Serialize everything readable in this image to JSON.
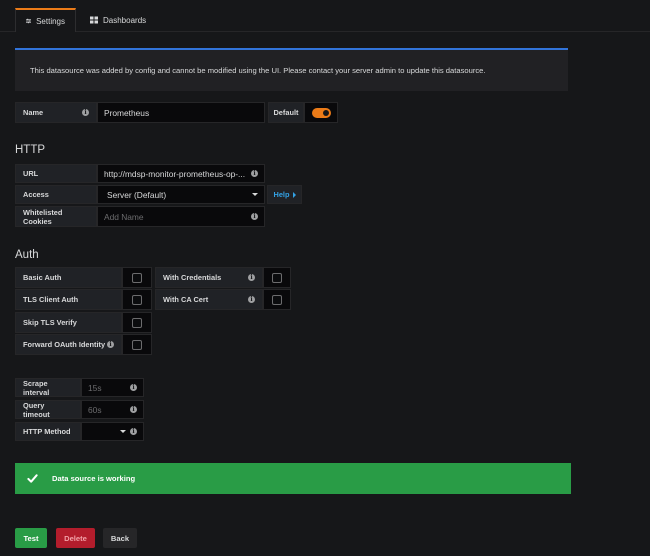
{
  "tabs": [
    {
      "label": "Settings",
      "icon": "sliders-icon",
      "active": true
    },
    {
      "label": "Dashboards",
      "icon": "grid-icon",
      "active": false
    }
  ],
  "banner": {
    "text": "This datasource was added by config and cannot be modified using the UI. Please contact your server admin to update this datasource."
  },
  "name_row": {
    "label": "Name",
    "value": "Prometheus",
    "default_label": "Default",
    "default_on": true
  },
  "http": {
    "heading": "HTTP",
    "url_label": "URL",
    "url_value": "http://mdsp-monitor-prometheus-op-...",
    "access_label": "Access",
    "access_value": "Server (Default)",
    "help_label": "Help",
    "cookies_label": "Whitelisted Cookies",
    "cookies_placeholder": "Add Name"
  },
  "auth": {
    "heading": "Auth",
    "basic_auth": "Basic Auth",
    "with_credentials": "With Credentials",
    "tls_client_auth": "TLS Client Auth",
    "with_ca_cert": "With CA Cert",
    "skip_tls_verify": "Skip TLS Verify",
    "forward_oauth": "Forward OAuth Identity"
  },
  "settings": {
    "scrape_label": "Scrape interval",
    "scrape_placeholder": "15s",
    "query_label": "Query timeout",
    "query_placeholder": "60s",
    "method_label": "HTTP Method",
    "method_value": ""
  },
  "status": {
    "text": "Data source is working",
    "color": "#299c46"
  },
  "buttons": {
    "test": "Test",
    "delete": "Delete",
    "back": "Back"
  },
  "colors": {
    "accent": "#eb7b18",
    "info_border": "#3274d9",
    "success": "#299c46",
    "danger": "#b31d2c",
    "link": "#33a2e5"
  }
}
